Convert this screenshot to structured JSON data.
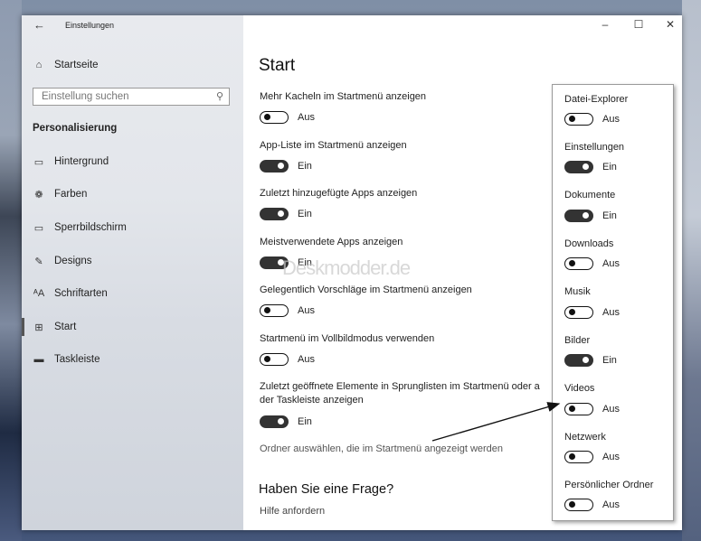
{
  "titlebar": {
    "title": "Einstellungen",
    "back_icon": "←",
    "minimize_icon": "–",
    "maximize_icon": "☐",
    "close_icon": "✕"
  },
  "sidebar": {
    "home_label": "Startseite",
    "search_placeholder": "Einstellung suchen",
    "section": "Personalisierung",
    "items": [
      {
        "label": "Hintergrund",
        "icon": "image-icon"
      },
      {
        "label": "Farben",
        "icon": "palette-icon"
      },
      {
        "label": "Sperrbildschirm",
        "icon": "lockscreen-icon"
      },
      {
        "label": "Designs",
        "icon": "brush-icon"
      },
      {
        "label": "Schriftarten",
        "icon": "font-icon"
      },
      {
        "label": "Start",
        "icon": "start-icon"
      },
      {
        "label": "Taskleiste",
        "icon": "taskbar-icon"
      }
    ]
  },
  "main": {
    "title": "Start",
    "settings": [
      {
        "label": "Mehr Kacheln im Startmenü anzeigen",
        "state": "Aus"
      },
      {
        "label": "App-Liste im Startmenü anzeigen",
        "state": "Ein"
      },
      {
        "label": "Zuletzt hinzugefügte Apps anzeigen",
        "state": "Ein"
      },
      {
        "label": "Meistverwendete Apps anzeigen",
        "state": "Ein"
      },
      {
        "label": "Gelegentlich Vorschläge im Startmenü anzeigen",
        "state": "Aus"
      },
      {
        "label": "Startmenü im Vollbildmodus verwenden",
        "state": "Aus"
      },
      {
        "label": "Zuletzt geöffnete Elemente in Sprunglisten im Startmenü oder a",
        "label2": "der Taskleiste anzeigen",
        "state": "Ein"
      }
    ],
    "folders_link": "Ordner auswählen, die im Startmenü angezeigt werden",
    "faq_title": "Haben Sie eine Frage?",
    "faq_link": "Hilfe anfordern",
    "watermark": "Deskmodder.de"
  },
  "folders": [
    {
      "label": "Datei-Explorer",
      "state": "Aus"
    },
    {
      "label": "Einstellungen",
      "state": "Ein"
    },
    {
      "label": "Dokumente",
      "state": "Ein"
    },
    {
      "label": "Downloads",
      "state": "Aus"
    },
    {
      "label": "Musik",
      "state": "Aus"
    },
    {
      "label": "Bilder",
      "state": "Ein"
    },
    {
      "label": "Videos",
      "state": "Aus"
    },
    {
      "label": "Netzwerk",
      "state": "Aus"
    },
    {
      "label": "Persönlicher Ordner",
      "state": "Aus"
    }
  ]
}
